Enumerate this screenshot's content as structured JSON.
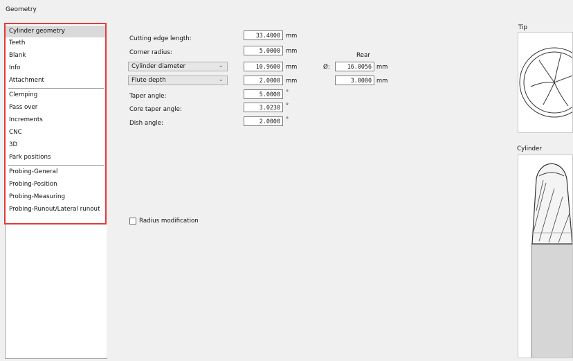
{
  "window": {
    "title": "Geometry"
  },
  "sidebar": {
    "items": [
      {
        "label": "Cylinder geometry",
        "selected": true
      },
      {
        "label": "Teeth"
      },
      {
        "label": "Blank"
      },
      {
        "label": "Info"
      },
      {
        "label": "Attachment"
      },
      {
        "label": "Clemping"
      },
      {
        "label": "Pass over"
      },
      {
        "label": "Increments"
      },
      {
        "label": "CNC"
      },
      {
        "label": "3D"
      },
      {
        "label": "Park positions"
      },
      {
        "label": "Probing-General"
      },
      {
        "label": "Probing-Position"
      },
      {
        "label": "Probing-Measuring"
      },
      {
        "label": "Probing-Runout/Lateral runout"
      }
    ],
    "highlight_color": "#e23a3a"
  },
  "form": {
    "cutting_edge_length": {
      "label": "Cutting edge length:",
      "value": "33.4000",
      "unit": "mm"
    },
    "corner_radius": {
      "label": "Corner radius:",
      "value": "5.0000",
      "unit": "mm"
    },
    "cylinder_diameter": {
      "selected": "Cylinder diameter",
      "value": "10.9600",
      "unit": "mm"
    },
    "flute_depth": {
      "selected": "Flute depth",
      "value": "2.0000",
      "unit": "mm"
    },
    "taper_angle": {
      "label": "Taper angle:",
      "value": "5.0000",
      "unit": "°"
    },
    "core_taper_angle": {
      "label": "Core taper angle:",
      "value": "3.0230",
      "unit": "°"
    },
    "dish_angle": {
      "label": "Dish angle:",
      "value": "2.0000",
      "unit": "°"
    },
    "rear": {
      "header": "Rear",
      "diameter_symbol": "Ø:",
      "diameter_value": "16.0056",
      "diameter_unit": "mm",
      "depth_value": "3.0000",
      "depth_unit": "mm"
    },
    "radius_modification": {
      "label": "Radius modification",
      "checked": false
    }
  },
  "preview": {
    "tip_title": "Tip",
    "cylinder_title": "Cylinder"
  }
}
